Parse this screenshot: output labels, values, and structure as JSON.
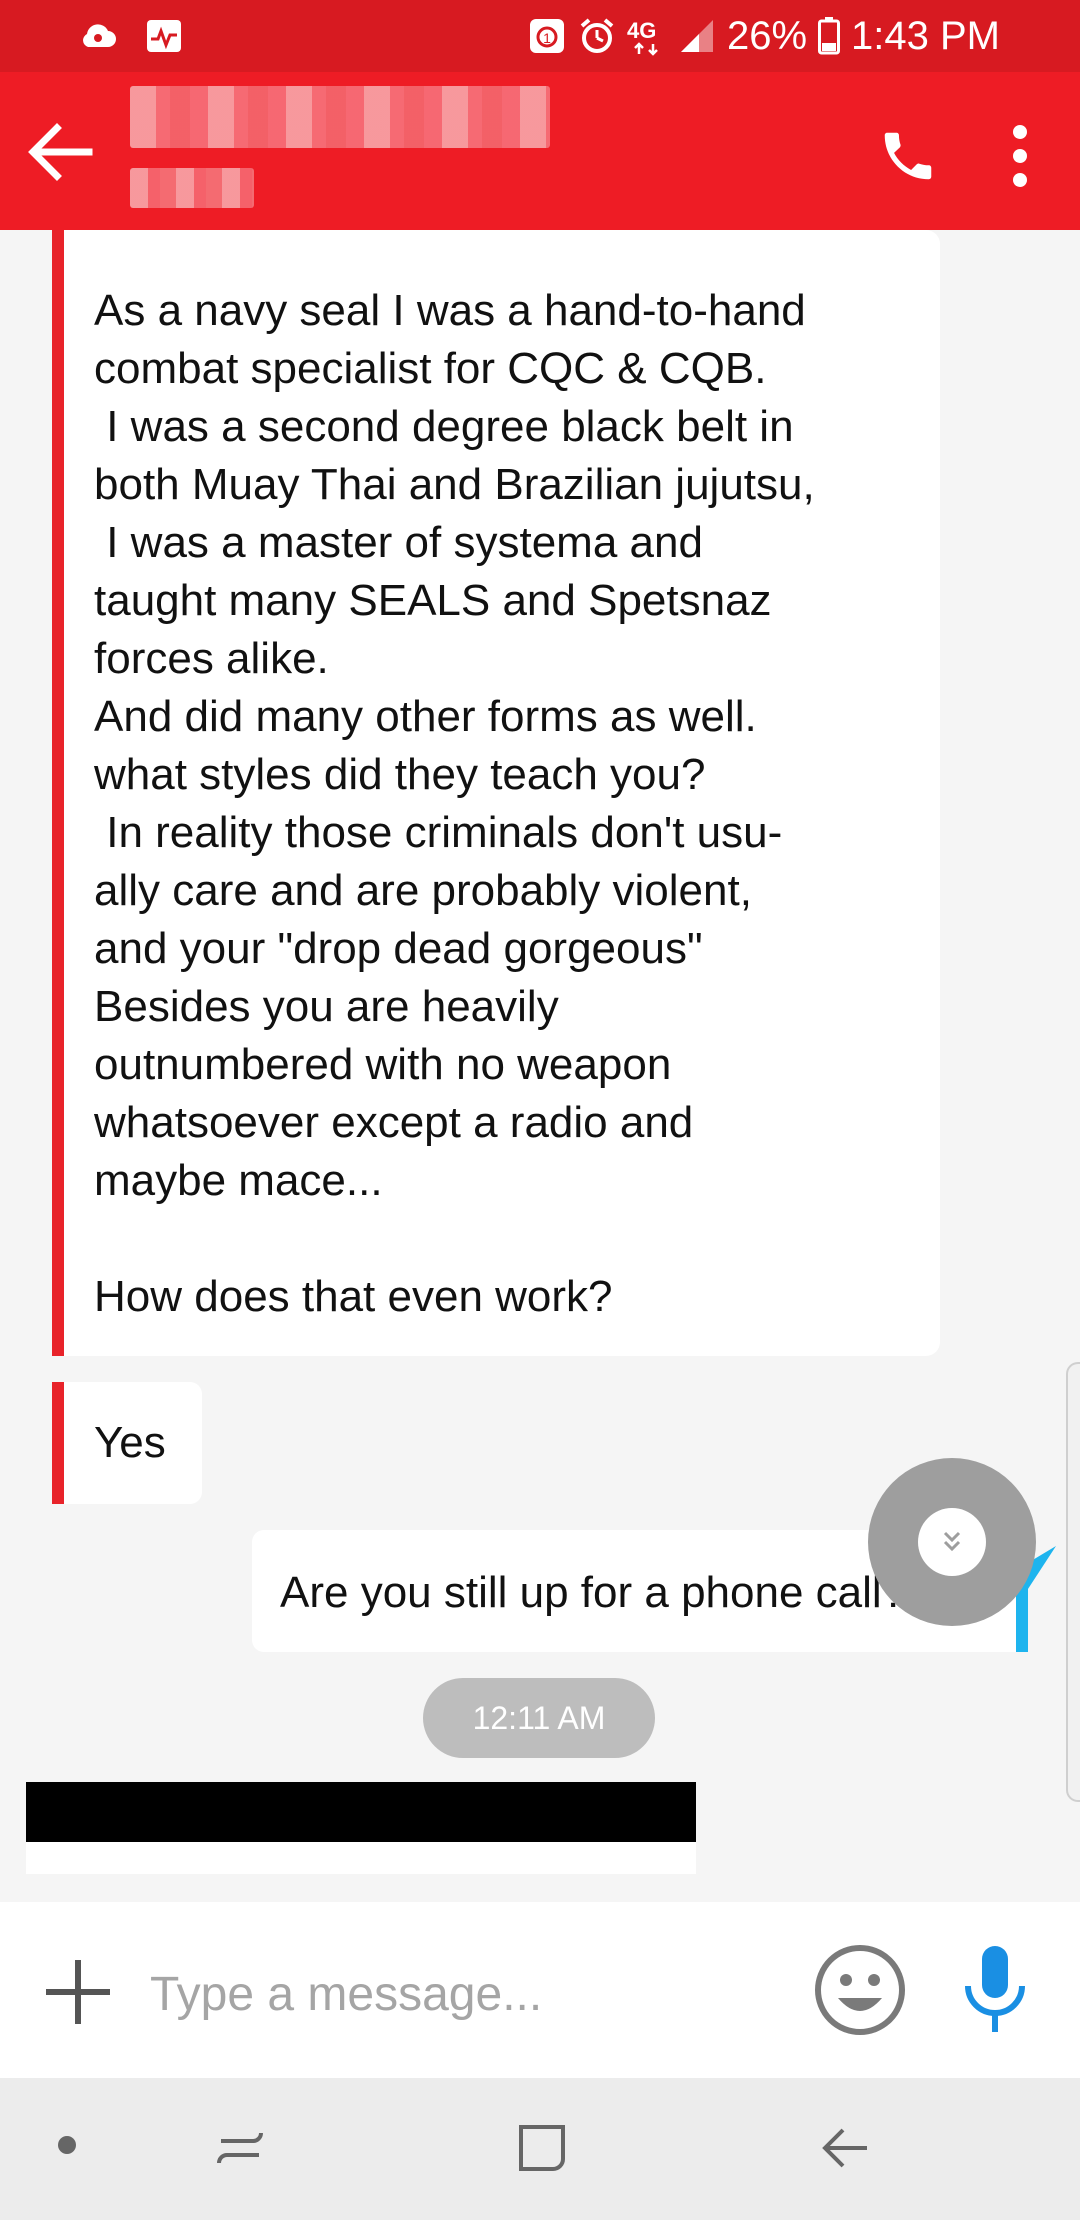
{
  "status_bar": {
    "battery": "26%",
    "time": "1:43 PM",
    "network": "4G",
    "icons": [
      "cloud-icon",
      "health-icon",
      "vibrate-alarm-icon",
      "alarm-icon",
      "network-4g-icon",
      "signal-icon",
      "battery-icon"
    ]
  },
  "header": {
    "contact_name": "",
    "contact_subtitle": "",
    "colors": {
      "status_bar": "#d71a21",
      "app_bar": "#ee1c25"
    }
  },
  "messages": [
    {
      "direction": "incoming",
      "text": "As a navy seal I was a hand-to-hand\ncombat specialist for CQC & CQB.\n I was a second degree black belt in\nboth Muay Thai and Brazilian jujutsu,\n I was a master of systema and\ntaught many SEALS and Spetsnaz\nforces alike.\nAnd did many other forms as well.\nwhat styles did they teach you?\n In reality those criminals don't usu-\nally care and are probably violent,\nand your \"drop dead gorgeous\"\nBesides you are heavily\noutnumbered with no weapon\nwhatsoever except a radio and\nmaybe mace...\n\nHow does that even work?"
    },
    {
      "direction": "incoming",
      "text": "Yes"
    },
    {
      "direction": "outgoing",
      "text": "Are you still up for a phone call?"
    }
  ],
  "timestamp": "12:11 AM",
  "composer": {
    "placeholder": "Type a message..."
  },
  "accent_colors": {
    "incoming": "#e8232a",
    "outgoing": "#1eb4ee",
    "mic": "#1a8fe3"
  }
}
